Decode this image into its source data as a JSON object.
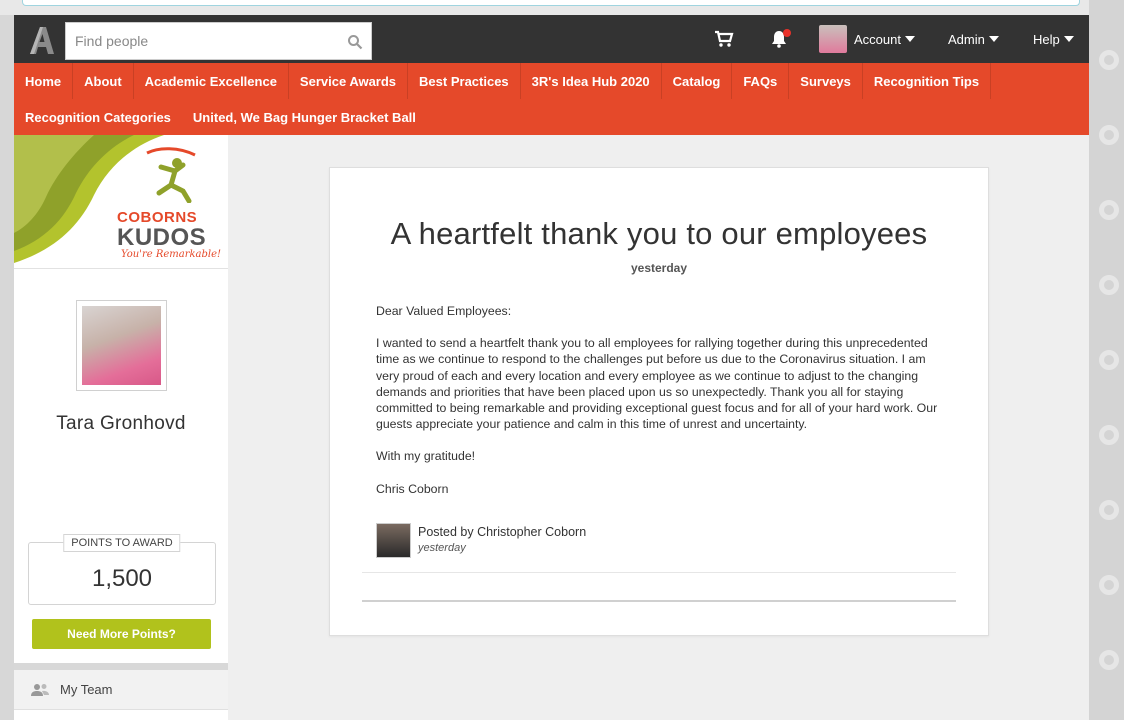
{
  "header": {
    "search_placeholder": "Find people",
    "account_label": "Account",
    "admin_label": "Admin",
    "help_label": "Help"
  },
  "nav": {
    "row1": [
      "Home",
      "About",
      "Academic Excellence",
      "Service Awards",
      "Best Practices",
      "3R's Idea Hub 2020",
      "Catalog",
      "FAQs",
      "Surveys",
      "Recognition Tips"
    ],
    "row2": [
      "Recognition Categories",
      "United, We Bag Hunger Bracket Ball"
    ]
  },
  "sidebar": {
    "brand_line1": "COBORNS",
    "brand_line2": "KUDOS",
    "brand_tagline": "You're Remarkable!",
    "profile_name": "Tara Gronhovd",
    "points_label": "POINTS TO AWARD",
    "points_value": "1,500",
    "need_points_label": "Need More Points?",
    "my_team_label": "My Team"
  },
  "post": {
    "title": "A heartfelt thank you to our employees",
    "date": "yesterday",
    "greeting": "Dear Valued Employees:",
    "body": "I wanted to send a heartfelt thank you to all employees for rallying together during this unprecedented time as we continue to respond to the challenges put before us due to the Coronavirus situation. I am very proud of each and every location and every employee as we continue to adjust to the changing demands and priorities that have been placed upon us so unexpectedly. Thank you all for staying committed to being remarkable and providing exceptional guest focus and for all of your hard work. Our guests appreciate your patience and calm in this time of unrest and uncertainty.",
    "closing": "With my gratitude!",
    "signature": "Chris Coborn",
    "posted_by": "Posted by Christopher Coborn",
    "posted_date": "yesterday"
  },
  "colors": {
    "header_bg": "#333333",
    "nav_bg": "#e5492a",
    "button_green": "#b1c21c"
  }
}
